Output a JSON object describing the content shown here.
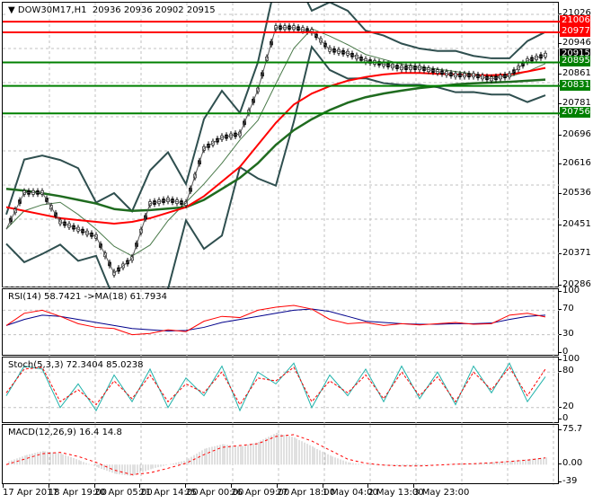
{
  "header": {
    "symbol": "DOW30M17,H1",
    "ohlc": "20936 20936 20902 20915",
    "menu_icon": "triangle-down-icon"
  },
  "colors": {
    "red": "#ff0000",
    "green": "#008000",
    "ma_green": "#1f6b1f",
    "band": "#2f4f4f",
    "rsi": "#ff0000",
    "rsi_ma": "#00008b",
    "stoch_main": "#20b2aa",
    "stoch_signal": "#ff0000",
    "macd_hist": "#c0c0c0"
  },
  "price_axis": {
    "ticks": [
      "21026",
      "20946",
      "20861",
      "20781",
      "20696",
      "20616",
      "20536",
      "20451",
      "20371",
      "20286"
    ],
    "min": 20286,
    "max": 21026
  },
  "levels": [
    {
      "price": 21006,
      "label": "21006",
      "color": "#ff0000"
    },
    {
      "price": 20977,
      "label": "20977",
      "color": "#ff0000"
    },
    {
      "price": 20895,
      "label": "20895",
      "color": "#008000"
    },
    {
      "price": 20831,
      "label": "20831",
      "color": "#008000"
    },
    {
      "price": 20756,
      "label": "20756",
      "color": "#008000"
    }
  ],
  "current_price": {
    "price": 20915,
    "label": "20915"
  },
  "chart_data": {
    "type": "line",
    "close": [
      20440,
      20540,
      20540,
      20460,
      20440,
      20420,
      20320,
      20360,
      20510,
      20520,
      20510,
      20660,
      20690,
      20700,
      20820,
      20990,
      20990,
      20980,
      20930,
      20920,
      20900,
      20890,
      20880,
      20880,
      20870,
      20860,
      20860,
      20850,
      20860,
      20900,
      20915
    ],
    "ma_red": [
      20500,
      20490,
      20480,
      20470,
      20465,
      20460,
      20455,
      20460,
      20470,
      20485,
      20500,
      20530,
      20570,
      20610,
      20670,
      20730,
      20780,
      20810,
      20830,
      20845,
      20855,
      20862,
      20866,
      20866,
      20864,
      20862,
      20860,
      20860,
      20862,
      20870,
      20880
    ],
    "ma_green": [
      20550,
      20545,
      20538,
      20530,
      20520,
      20510,
      20495,
      20490,
      20492,
      20496,
      20500,
      20520,
      20550,
      20580,
      20620,
      20670,
      20710,
      20740,
      20765,
      20785,
      20800,
      20810,
      20818,
      20825,
      20830,
      20835,
      20838,
      20840,
      20842,
      20845,
      20848
    ],
    "rsi": {
      "title": "RSI(14) 58.7421  ->MA(18) 61.7934",
      "ticks": [
        "100",
        "70",
        "30",
        "0"
      ],
      "values": [
        45,
        65,
        70,
        60,
        48,
        42,
        40,
        30,
        32,
        38,
        35,
        52,
        60,
        58,
        70,
        75,
        78,
        72,
        55,
        48,
        50,
        45,
        48,
        46,
        48,
        50,
        47,
        48,
        62,
        65,
        59
      ],
      "ma": [
        45,
        55,
        62,
        60,
        55,
        50,
        45,
        40,
        38,
        36,
        37,
        42,
        50,
        55,
        60,
        65,
        70,
        72,
        68,
        60,
        52,
        50,
        48,
        47,
        47,
        48,
        48,
        49,
        55,
        60,
        62
      ]
    },
    "stoch": {
      "title": "Stoch(5,3,3) 72.3404 85.0238",
      "ticks": [
        "100",
        "80",
        "20",
        "0"
      ],
      "main": [
        40,
        90,
        85,
        20,
        60,
        15,
        75,
        30,
        85,
        20,
        70,
        40,
        90,
        15,
        80,
        60,
        95,
        20,
        75,
        40,
        85,
        30,
        90,
        35,
        80,
        25,
        90,
        45,
        95,
        30,
        72
      ],
      "signal": [
        45,
        85,
        88,
        30,
        50,
        25,
        65,
        35,
        75,
        30,
        60,
        45,
        80,
        25,
        70,
        65,
        88,
        30,
        65,
        45,
        75,
        35,
        80,
        40,
        72,
        30,
        80,
        50,
        88,
        40,
        85
      ]
    },
    "macd": {
      "title": "MACD(12,26,9) 16.4 14.8",
      "ticks": [
        "75.7",
        "0.00",
        "-39"
      ],
      "hist": [
        5,
        20,
        30,
        25,
        10,
        -5,
        -20,
        -25,
        -10,
        0,
        10,
        35,
        45,
        40,
        50,
        70,
        60,
        40,
        20,
        5,
        0,
        -2,
        -3,
        -2,
        0,
        2,
        3,
        5,
        8,
        12,
        16
      ],
      "signal": [
        0,
        12,
        24,
        27,
        18,
        5,
        -12,
        -22,
        -18,
        -8,
        3,
        22,
        38,
        42,
        46,
        62,
        66,
        52,
        32,
        12,
        3,
        -1,
        -3,
        -3,
        -1,
        1,
        2,
        4,
        7,
        10,
        14.8
      ]
    },
    "x_labels": [
      "17 Apr 2017",
      "18 Apr 19:00",
      "20 Apr 05:00",
      "21 Apr 14:00",
      "25 Apr 00:00",
      "26 Apr 09:00",
      "27 Apr 18:00",
      "1 May 04:00",
      "2 May 13:00",
      "3 May 23:00"
    ]
  }
}
